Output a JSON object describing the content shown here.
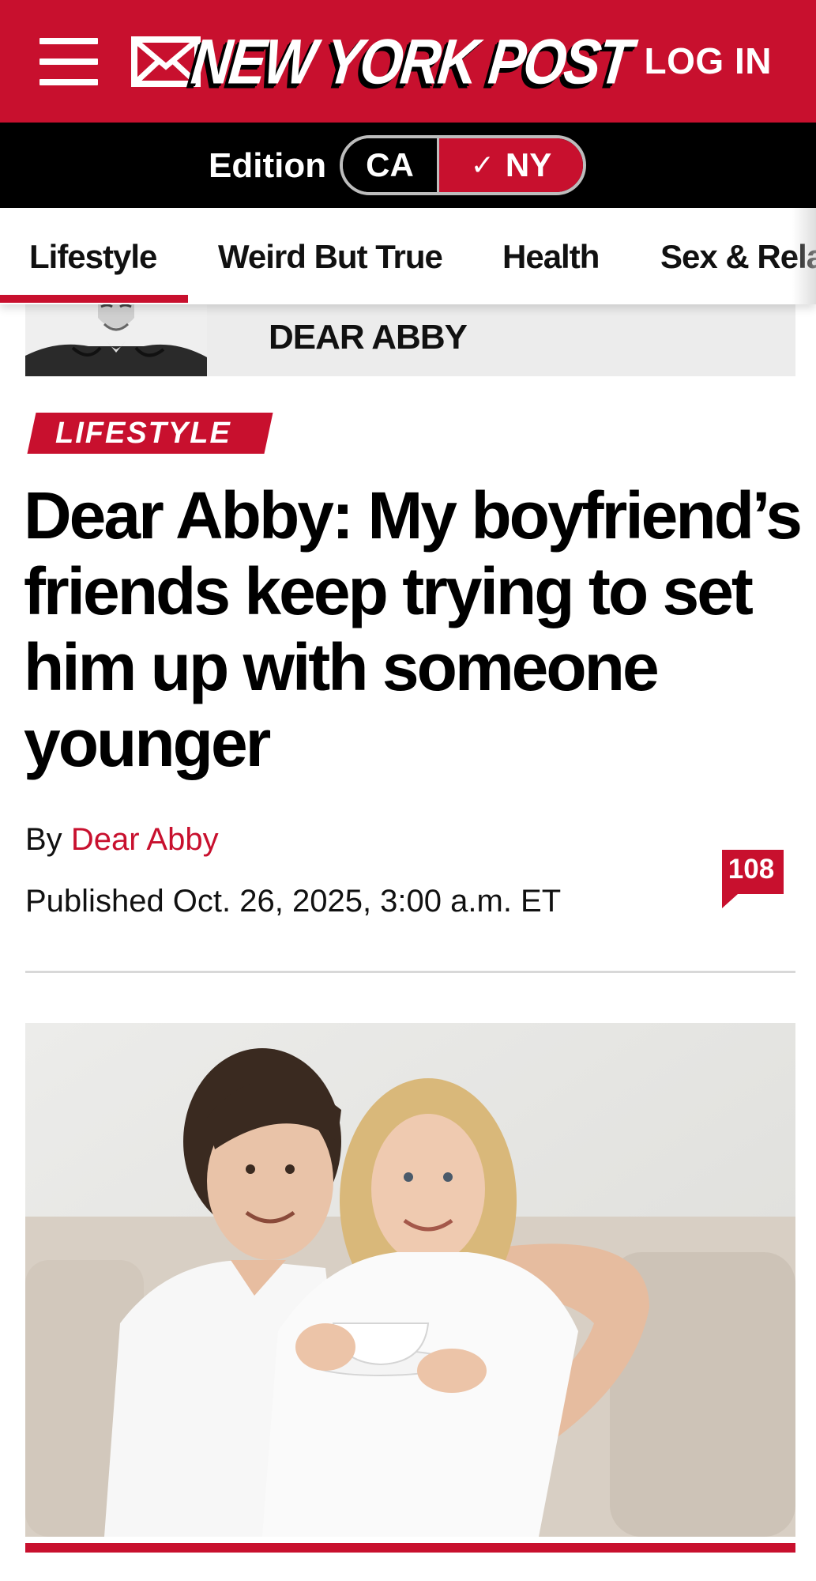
{
  "header": {
    "logo_text": "NEW YORK POST",
    "login_label": "LOG IN",
    "menu_icon": "hamburger-menu-icon",
    "mail_icon": "envelope-icon",
    "brand_color": "#c8102e"
  },
  "edition": {
    "label": "Edition",
    "options": [
      "CA",
      "NY"
    ],
    "selected": "NY"
  },
  "section_nav": {
    "items": [
      "Lifestyle",
      "Weird But True",
      "Health",
      "Sex & Rela"
    ],
    "active": "Lifestyle"
  },
  "column_banner": {
    "title": "DEAR ABBY"
  },
  "article": {
    "kicker": "LIFESTYLE",
    "headline": "Dear Abby: My boyfriend’s friends keep trying to set him up with someone younger",
    "by_prefix": "By",
    "author": "Dear Abby",
    "published": "Published Oct. 26, 2025, 3:00 a.m. ET",
    "comment_count": "108"
  }
}
